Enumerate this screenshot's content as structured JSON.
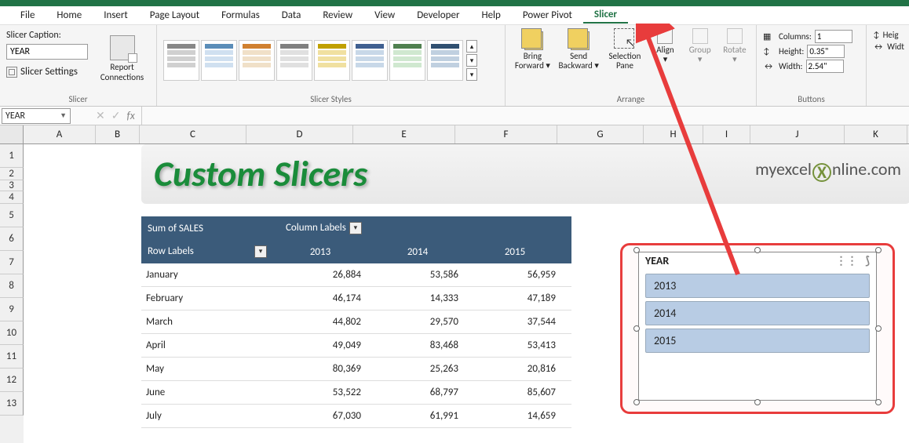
{
  "menu": {
    "tabs": [
      "File",
      "Home",
      "Insert",
      "Page Layout",
      "Formulas",
      "Data",
      "Review",
      "View",
      "Developer",
      "Help",
      "Power Pivot",
      "Slicer"
    ],
    "active": "Slicer"
  },
  "ribbon": {
    "slicer_caption_label": "Slicer Caption:",
    "slicer_caption_value": "YEAR",
    "slicer_settings": "Slicer Settings",
    "slicer_group": "Slicer",
    "report_connections": "Report Connections",
    "slicer_styles_group": "Slicer Styles",
    "bring_forward": "Bring Forward",
    "send_backward": "Send Backward",
    "selection_pane": "Selection Pane",
    "align": "Align",
    "group": "Group",
    "rotate": "Rotate",
    "arrange_group": "Arrange",
    "columns_label": "Columns:",
    "columns_value": "1",
    "height_label": "Height:",
    "height_value": "0.35\"",
    "width_label": "Width:",
    "width_value": "2.54\"",
    "buttons_group": "Buttons",
    "size_height": "Heig",
    "size_width": "Widt"
  },
  "name_box": "YEAR",
  "fx_label": "fx",
  "columns": [
    "A",
    "B",
    "C",
    "D",
    "E",
    "F",
    "G",
    "H",
    "I",
    "J",
    "K"
  ],
  "rows": [
    "1",
    "2",
    "3",
    "4",
    "5",
    "6",
    "7",
    "8",
    "9",
    "10",
    "11",
    "12",
    "13"
  ],
  "banner_title": "Custom Slicers",
  "logo_text_pre": "myexcel",
  "logo_text_post": "nline.com",
  "pivot": {
    "sum_label": "Sum of SALES",
    "col_labels": "Column Labels",
    "row_labels": "Row Labels",
    "years": [
      "2013",
      "2014",
      "2015"
    ],
    "rows": [
      {
        "m": "January",
        "v": [
          "26,884",
          "53,586",
          "56,959"
        ]
      },
      {
        "m": "February",
        "v": [
          "46,174",
          "14,333",
          "47,189"
        ]
      },
      {
        "m": "March",
        "v": [
          "44,802",
          "29,570",
          "37,544"
        ]
      },
      {
        "m": "April",
        "v": [
          "49,049",
          "83,468",
          "53,413"
        ]
      },
      {
        "m": "May",
        "v": [
          "80,369",
          "25,263",
          "20,816"
        ]
      },
      {
        "m": "June",
        "v": [
          "53,522",
          "68,797",
          "85,607"
        ]
      },
      {
        "m": "July",
        "v": [
          "67,030",
          "61,991",
          "14,659"
        ]
      }
    ]
  },
  "slicer": {
    "title": "YEAR",
    "items": [
      "2013",
      "2014",
      "2015"
    ]
  }
}
